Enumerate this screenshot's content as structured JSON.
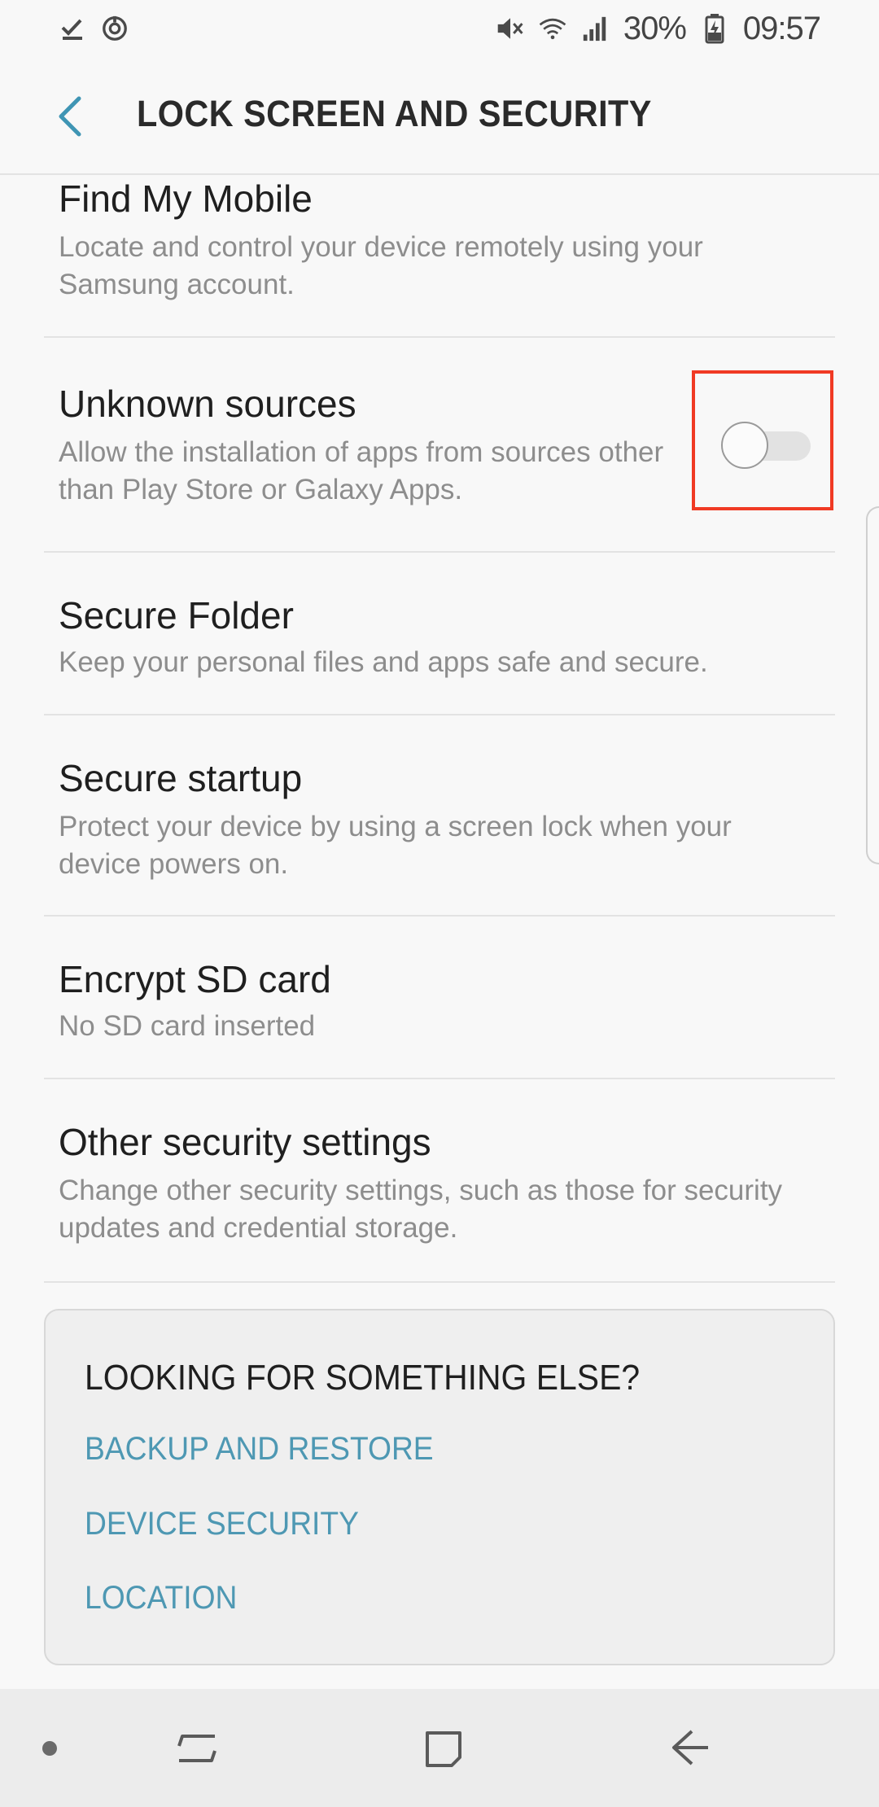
{
  "status_bar": {
    "battery": "30%",
    "time": "09:57",
    "icons_left": [
      "download-done-icon",
      "sync-icon"
    ],
    "icons_right": [
      "mute-icon",
      "wifi-icon",
      "signal-icon",
      "battery-charging-icon"
    ]
  },
  "header": {
    "title": "LOCK SCREEN AND SECURITY",
    "back_icon": "chevron-left-icon"
  },
  "settings": [
    {
      "title": "Find My Mobile",
      "desc": "Locate and control your device remotely using your Samsung account."
    },
    {
      "title": "Unknown sources",
      "desc": "Allow the installation of apps from sources other than Play Store or Galaxy Apps.",
      "toggle_on": false
    },
    {
      "title": "Secure Folder",
      "desc": "Keep your personal files and apps safe and secure."
    },
    {
      "title": "Secure startup",
      "desc": "Protect your device by using a screen lock when your device powers on."
    },
    {
      "title": "Encrypt SD card",
      "desc": "No SD card inserted"
    },
    {
      "title": "Other security settings",
      "desc": "Change other security settings, such as those for security updates and credential storage."
    }
  ],
  "suggestions": {
    "title": "LOOKING FOR SOMETHING ELSE?",
    "links": [
      "BACKUP AND RESTORE",
      "DEVICE SECURITY",
      "LOCATION"
    ]
  },
  "nav_bar": {
    "icons": [
      "dot-indicator-icon",
      "recents-icon",
      "home-icon",
      "back-icon"
    ]
  },
  "colors": {
    "accent": "#4e98b3",
    "highlight": "#f03a24",
    "background": "#f8f8f8",
    "card": "#efefef"
  }
}
